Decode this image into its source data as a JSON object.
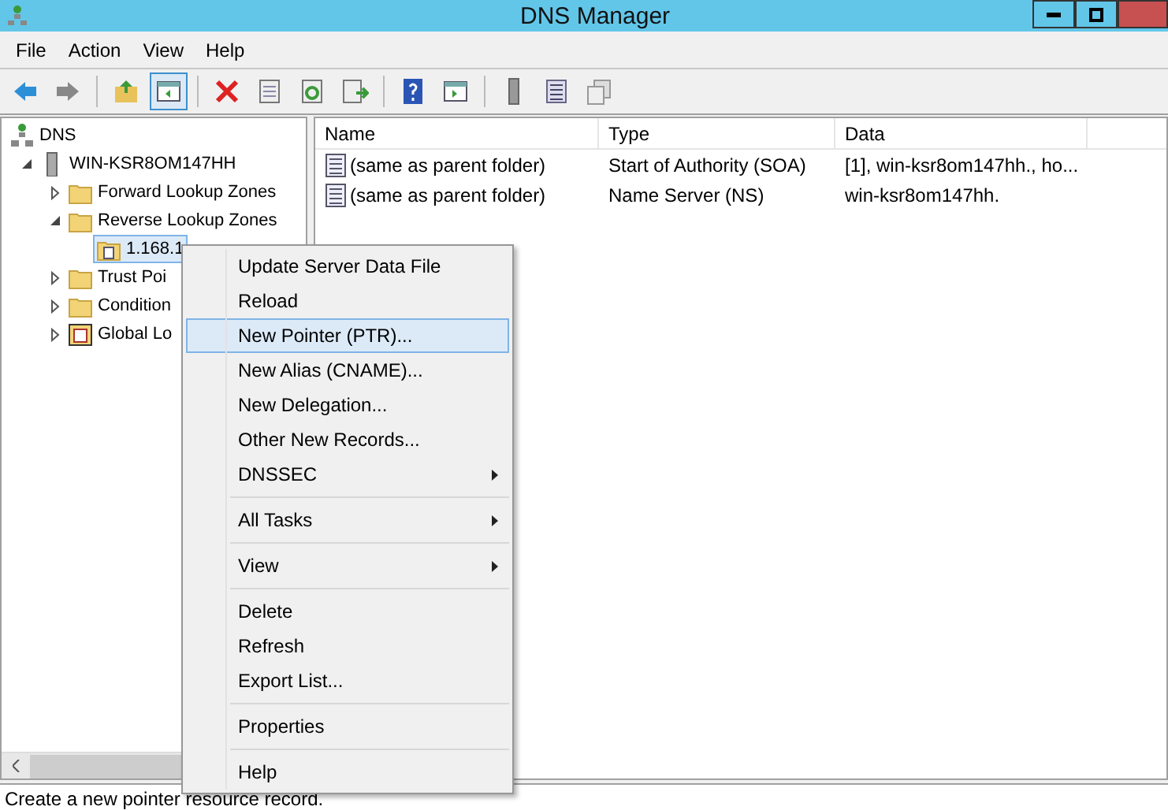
{
  "window": {
    "title": "DNS Manager"
  },
  "menu_bar": [
    "File",
    "Action",
    "View",
    "Help"
  ],
  "toolbar": [
    {
      "kind": "back"
    },
    {
      "kind": "forward"
    },
    {
      "kind": "sep"
    },
    {
      "kind": "up"
    },
    {
      "kind": "pane",
      "selected": true
    },
    {
      "kind": "sep"
    },
    {
      "kind": "delete"
    },
    {
      "kind": "props"
    },
    {
      "kind": "refresh"
    },
    {
      "kind": "export"
    },
    {
      "kind": "sep"
    },
    {
      "kind": "help"
    },
    {
      "kind": "pane2"
    },
    {
      "kind": "sep"
    },
    {
      "kind": "server"
    },
    {
      "kind": "list"
    },
    {
      "kind": "copy"
    }
  ],
  "tree": [
    {
      "label": "DNS",
      "kind": "dns",
      "children": [
        {
          "label": "WIN-KSR8OM147HH",
          "kind": "server",
          "expanded": true,
          "children": [
            {
              "label": "Forward Lookup Zones",
              "kind": "folder",
              "expanded": false
            },
            {
              "label": "Reverse Lookup Zones",
              "kind": "folder",
              "expanded": true,
              "children": [
                {
                  "label": "1.168.1",
                  "kind": "zone",
                  "selected": true
                }
              ]
            },
            {
              "label": "Trust Poi",
              "kind": "folder",
              "expanded": false
            },
            {
              "label": "Condition",
              "kind": "folder",
              "expanded": false
            },
            {
              "label": "Global Lo",
              "kind": "global",
              "expanded": false
            }
          ]
        }
      ]
    }
  ],
  "table": {
    "columns": [
      "Name",
      "Type",
      "Data"
    ],
    "rows": [
      {
        "name": "(same as parent folder)",
        "type": "Start of Authority (SOA)",
        "data": "[1], win-ksr8om147hh., ho..."
      },
      {
        "name": "(same as parent folder)",
        "type": "Name Server (NS)",
        "data": "win-ksr8om147hh."
      }
    ]
  },
  "context_menu": [
    {
      "kind": "item",
      "label": "Update Server Data File",
      "selected": false
    },
    {
      "kind": "item",
      "label": "Reload",
      "selected": false
    },
    {
      "kind": "item",
      "label": "New Pointer (PTR)...",
      "selected": true
    },
    {
      "kind": "item",
      "label": "New Alias (CNAME)...",
      "selected": false
    },
    {
      "kind": "item",
      "label": "New Delegation...",
      "selected": false
    },
    {
      "kind": "item",
      "label": "Other New Records...",
      "selected": false
    },
    {
      "kind": "submenu",
      "label": "DNSSEC",
      "selected": false
    },
    {
      "kind": "sep"
    },
    {
      "kind": "submenu",
      "label": "All Tasks",
      "selected": false
    },
    {
      "kind": "sep"
    },
    {
      "kind": "submenu",
      "label": "View",
      "selected": false
    },
    {
      "kind": "sep"
    },
    {
      "kind": "item",
      "label": "Delete",
      "selected": false
    },
    {
      "kind": "item",
      "label": "Refresh",
      "selected": false
    },
    {
      "kind": "item",
      "label": "Export List...",
      "selected": false
    },
    {
      "kind": "sep"
    },
    {
      "kind": "item",
      "label": "Properties",
      "selected": false
    },
    {
      "kind": "sep"
    },
    {
      "kind": "item",
      "label": "Help",
      "selected": false
    }
  ],
  "status_bar": "Create a new pointer resource record."
}
